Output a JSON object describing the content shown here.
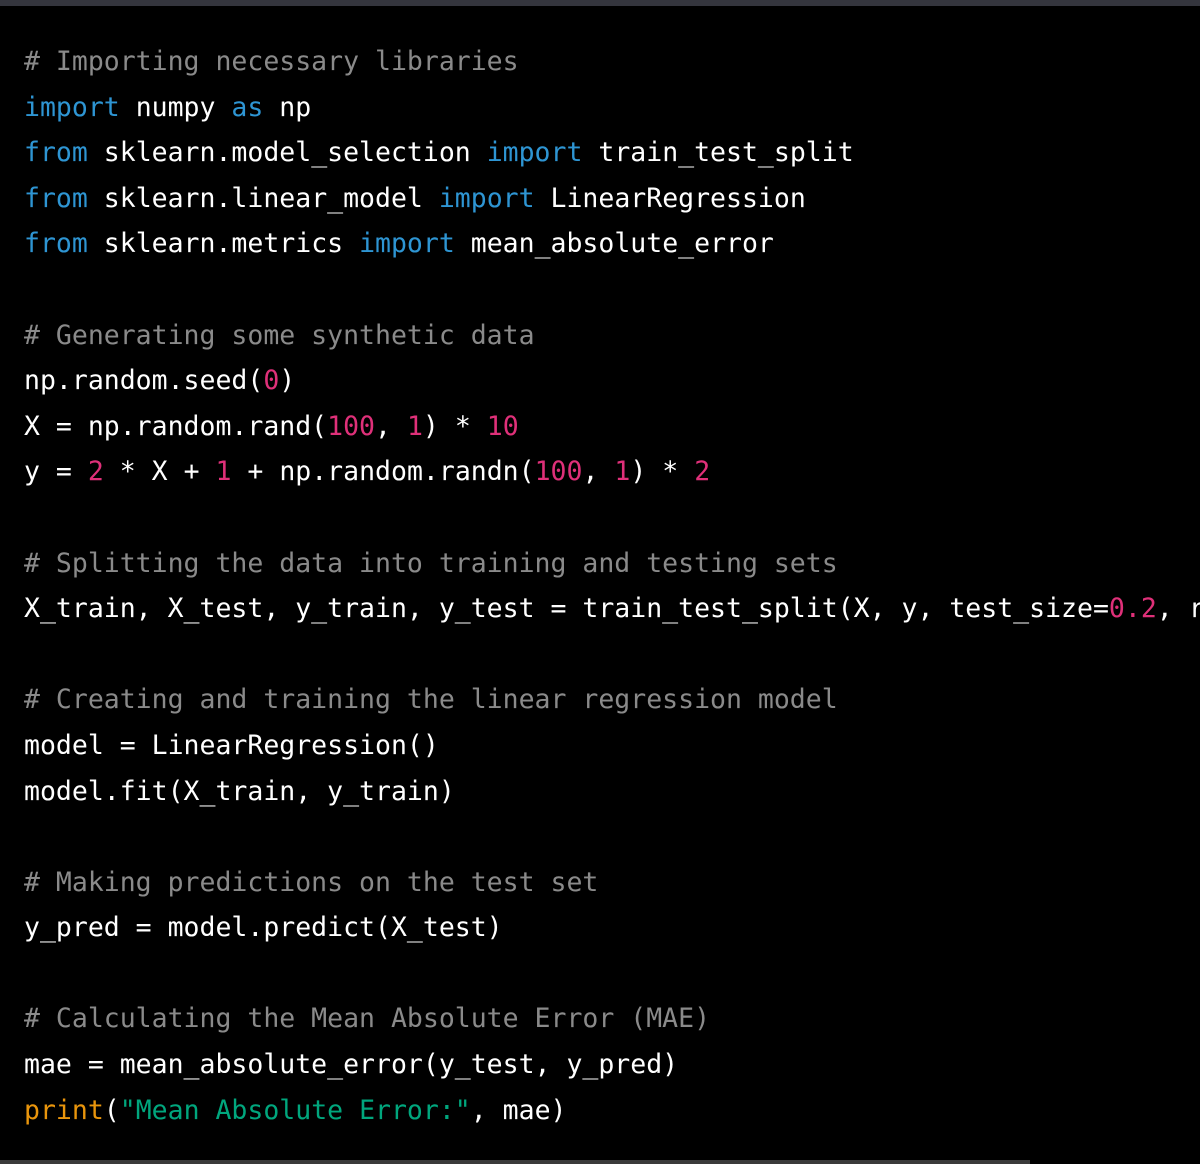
{
  "theme": {
    "background": "#000000",
    "top_bar": "#34353d",
    "text": "#ffffff",
    "comment": "#8a8a8a",
    "keyword": "#2e95d3",
    "number": "#df3079",
    "string": "#00a67d",
    "builtin": "#e9950c"
  },
  "code": {
    "language": "python",
    "lines": [
      [
        {
          "t": "# Importing necessary libraries",
          "k": "comment"
        }
      ],
      [
        {
          "t": "import",
          "k": "keyword"
        },
        {
          "t": " numpy ",
          "k": "plain"
        },
        {
          "t": "as",
          "k": "keyword"
        },
        {
          "t": " np",
          "k": "plain"
        }
      ],
      [
        {
          "t": "from",
          "k": "keyword"
        },
        {
          "t": " sklearn.model_selection ",
          "k": "plain"
        },
        {
          "t": "import",
          "k": "keyword"
        },
        {
          "t": " train_test_split",
          "k": "plain"
        }
      ],
      [
        {
          "t": "from",
          "k": "keyword"
        },
        {
          "t": " sklearn.linear_model ",
          "k": "plain"
        },
        {
          "t": "import",
          "k": "keyword"
        },
        {
          "t": " LinearRegression",
          "k": "plain"
        }
      ],
      [
        {
          "t": "from",
          "k": "keyword"
        },
        {
          "t": " sklearn.metrics ",
          "k": "plain"
        },
        {
          "t": "import",
          "k": "keyword"
        },
        {
          "t": " mean_absolute_error",
          "k": "plain"
        }
      ],
      [],
      [
        {
          "t": "# Generating some synthetic data",
          "k": "comment"
        }
      ],
      [
        {
          "t": "np.random.seed(",
          "k": "plain"
        },
        {
          "t": "0",
          "k": "number"
        },
        {
          "t": ")",
          "k": "plain"
        }
      ],
      [
        {
          "t": "X = np.random.rand(",
          "k": "plain"
        },
        {
          "t": "100",
          "k": "number"
        },
        {
          "t": ", ",
          "k": "plain"
        },
        {
          "t": "1",
          "k": "number"
        },
        {
          "t": ") * ",
          "k": "plain"
        },
        {
          "t": "10",
          "k": "number"
        }
      ],
      [
        {
          "t": "y = ",
          "k": "plain"
        },
        {
          "t": "2",
          "k": "number"
        },
        {
          "t": " * X + ",
          "k": "plain"
        },
        {
          "t": "1",
          "k": "number"
        },
        {
          "t": " + np.random.randn(",
          "k": "plain"
        },
        {
          "t": "100",
          "k": "number"
        },
        {
          "t": ", ",
          "k": "plain"
        },
        {
          "t": "1",
          "k": "number"
        },
        {
          "t": ") * ",
          "k": "plain"
        },
        {
          "t": "2",
          "k": "number"
        }
      ],
      [],
      [
        {
          "t": "# Splitting the data into training and testing sets",
          "k": "comment"
        }
      ],
      [
        {
          "t": "X_train, X_test, y_train, y_test = train_test_split(X, y, test_size=",
          "k": "plain"
        },
        {
          "t": "0.2",
          "k": "number"
        },
        {
          "t": ", r",
          "k": "plain"
        }
      ],
      [],
      [
        {
          "t": "# Creating and training the linear regression model",
          "k": "comment"
        }
      ],
      [
        {
          "t": "model = LinearRegression()",
          "k": "plain"
        }
      ],
      [
        {
          "t": "model.fit(X_train, y_train)",
          "k": "plain"
        }
      ],
      [],
      [
        {
          "t": "# Making predictions on the test set",
          "k": "comment"
        }
      ],
      [
        {
          "t": "y_pred = model.predict(X_test)",
          "k": "plain"
        }
      ],
      [],
      [
        {
          "t": "# Calculating the Mean Absolute Error (MAE)",
          "k": "comment"
        }
      ],
      [
        {
          "t": "mae = mean_absolute_error(y_test, y_pred)",
          "k": "plain"
        }
      ],
      [
        {
          "t": "print",
          "k": "builtin"
        },
        {
          "t": "(",
          "k": "plain"
        },
        {
          "t": "\"Mean Absolute Error:\"",
          "k": "string"
        },
        {
          "t": ", mae)",
          "k": "plain"
        }
      ]
    ]
  }
}
